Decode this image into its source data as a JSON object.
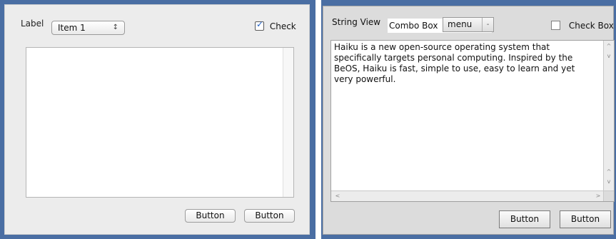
{
  "left_window": {
    "label": "Label",
    "popup_value": "Item 1",
    "popup_arrows": "↕",
    "check_label": "Check",
    "check_mark": "✓",
    "buttons": [
      "Button",
      "Button"
    ]
  },
  "right_window": {
    "string_view": "String View",
    "combo_label": "Combo Box",
    "menu_value": "menu",
    "menu_mark": "-",
    "check_label": "Check Box",
    "text": "Haiku is a new open-source operating system that\nspecifically targets personal computing. Inspired by the\nBeOS, Haiku is fast, simple to use, easy to learn and yet\nvery powerful.",
    "scroll_glyphs": {
      "up": "^",
      "down": "v",
      "left": "<",
      "right": ">"
    },
    "buttons": [
      "Button",
      "Button"
    ]
  },
  "colors": {
    "background_blue": "#4a6ea3",
    "left_window_bg": "#ececec",
    "right_window_bg": "#dcdcdc",
    "checkbox_accent": "#1f61c8"
  }
}
